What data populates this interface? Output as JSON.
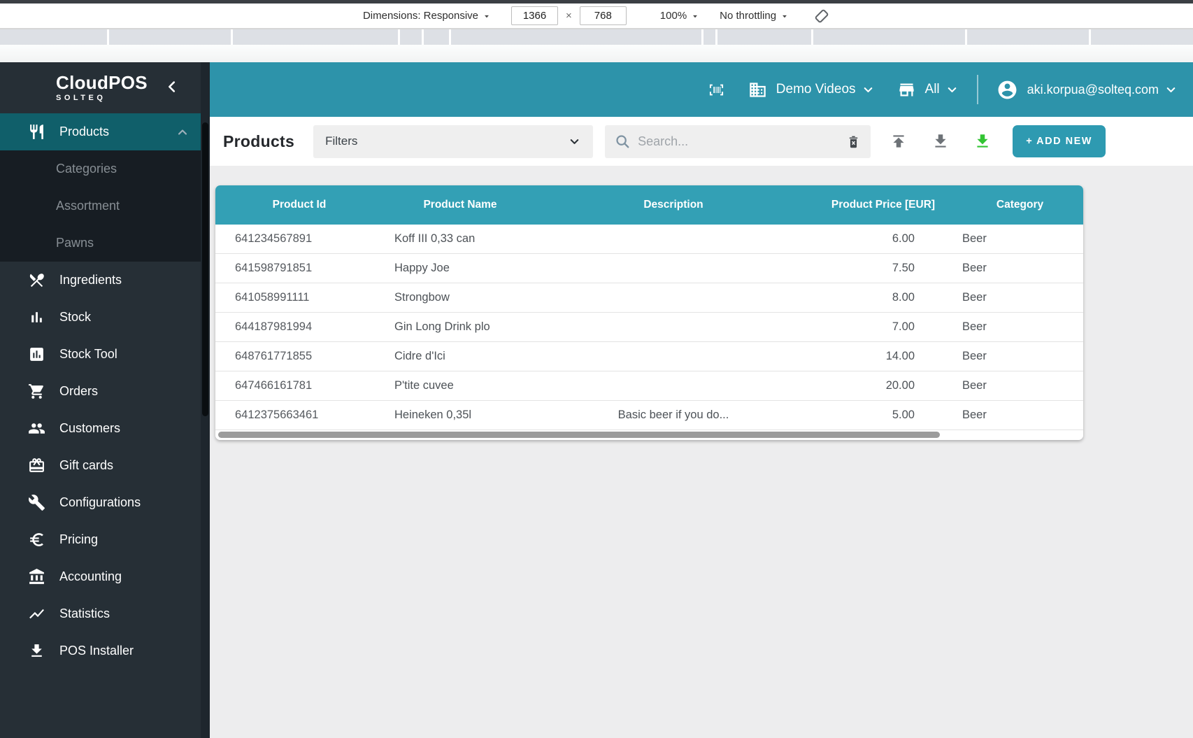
{
  "devtools": {
    "dimensions_label": "Dimensions: Responsive",
    "width_value": "1366",
    "times_symbol": "×",
    "height_value": "768",
    "zoom_value": "100%",
    "throttling_value": "No throttling"
  },
  "appbar": {
    "company_selector": "Demo Videos",
    "store_selector": "All",
    "user_email": "aki.korpua@solteq.com"
  },
  "sidebar": {
    "logo_title": "CloudPOS",
    "logo_subtitle": "SOLTEQ",
    "items": [
      {
        "label": "Products",
        "icon": "restaurant-icon",
        "active": true,
        "expanded": true,
        "children": [
          "Categories",
          "Assortment",
          "Pawns"
        ]
      },
      {
        "label": "Ingredients",
        "icon": "crossed-utensils-icon"
      },
      {
        "label": "Stock",
        "icon": "bar-chart-icon"
      },
      {
        "label": "Stock Tool",
        "icon": "assessment-icon"
      },
      {
        "label": "Orders",
        "icon": "shopping-cart-icon"
      },
      {
        "label": "Customers",
        "icon": "people-icon"
      },
      {
        "label": "Gift cards",
        "icon": "gift-card-icon"
      },
      {
        "label": "Configurations",
        "icon": "wrench-icon"
      },
      {
        "label": "Pricing",
        "icon": "euro-icon"
      },
      {
        "label": "Accounting",
        "icon": "bank-icon"
      },
      {
        "label": "Statistics",
        "icon": "line-chart-icon"
      },
      {
        "label": "POS Installer",
        "icon": "download-icon"
      }
    ]
  },
  "toolbar": {
    "page_title": "Products",
    "filters_label": "Filters",
    "search_placeholder": "Search...",
    "add_new_label": "+ ADD NEW"
  },
  "table": {
    "columns": [
      "Product Id",
      "Product Name",
      "Description",
      "Product Price [EUR]",
      "Category"
    ],
    "rows": [
      {
        "id": "641234567891",
        "name": "Koff III 0,33 can",
        "description": "",
        "price": "6.00",
        "category": "Beer"
      },
      {
        "id": "641598791851",
        "name": "Happy Joe",
        "description": "",
        "price": "7.50",
        "category": "Beer"
      },
      {
        "id": "641058991111",
        "name": "Strongbow",
        "description": "",
        "price": "8.00",
        "category": "Beer"
      },
      {
        "id": "644187981994",
        "name": "Gin Long Drink plo",
        "description": "",
        "price": "7.00",
        "category": "Beer"
      },
      {
        "id": "648761771855",
        "name": "Cidre d'Ici",
        "description": "",
        "price": "14.00",
        "category": "Beer"
      },
      {
        "id": "647466161781",
        "name": "P'tite cuvee",
        "description": "",
        "price": "20.00",
        "category": "Beer"
      },
      {
        "id": "6412375663461",
        "name": "Heineken 0,35l",
        "description": "Basic beer if you do...",
        "price": "5.00",
        "category": "Beer"
      }
    ]
  },
  "colors": {
    "header_teal": "#2d93aa",
    "table_header_teal": "#33a0b5",
    "active_item_teal": "#105f6a",
    "sidebar_dark": "#262f36",
    "subnav_dark": "#171d23",
    "accent_green": "#32c433",
    "add_button_teal": "#2e9ab1",
    "content_background": "#ededee"
  }
}
